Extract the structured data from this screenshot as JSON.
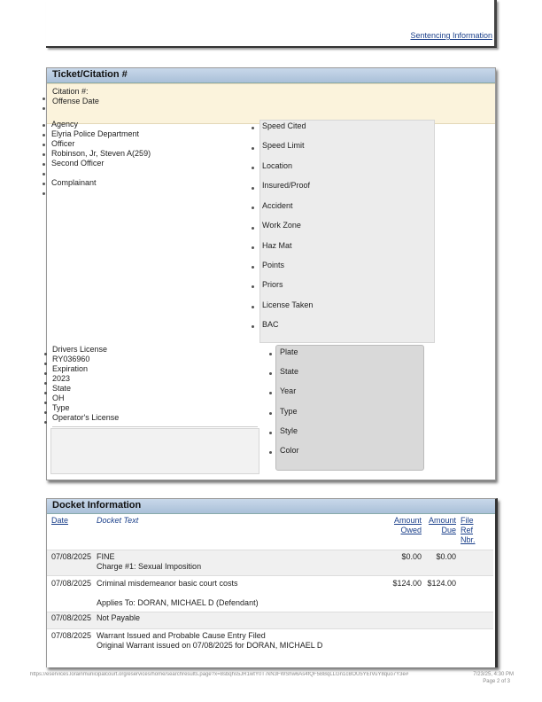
{
  "top": {
    "sentencing_link": "Sentencing Information"
  },
  "ticket": {
    "title": "Ticket/Citation #",
    "citation_label": "Citation #:",
    "offense_date_label": "Offense Date",
    "left": [
      {
        "text": "Agency"
      },
      {
        "text": "Elyria Police Department"
      },
      {
        "text": "Officer"
      },
      {
        "text": "Robinson, Jr, Steven A(259)"
      },
      {
        "text": "Second Officer"
      },
      {
        "text": ""
      },
      {
        "text": "Complainant"
      }
    ],
    "right": [
      "Speed Cited",
      "Speed Limit",
      "Location",
      "Insured/Proof",
      "Accident",
      "Work Zone",
      "Haz Mat",
      "Points",
      "Priors",
      "License Taken",
      "BAC"
    ],
    "license": [
      {
        "text": "Drivers License"
      },
      {
        "text": "RY036960"
      },
      {
        "text": "Expiration"
      },
      {
        "text": "2023"
      },
      {
        "text": "State"
      },
      {
        "text": "OH"
      },
      {
        "text": "Type"
      },
      {
        "text": "Operator's License"
      }
    ],
    "vehicle": [
      "Plate",
      "State",
      "Year",
      "Type",
      "Style",
      "Color"
    ]
  },
  "docket": {
    "title": "Docket Information",
    "headers": {
      "date": "Date",
      "text": "Docket Text",
      "amount_owed_1": "Amount",
      "amount_owed_2": "Owed",
      "amount_due_1": "Amount",
      "amount_due_2": "Due",
      "file_1": "File",
      "file_2": "Ref",
      "file_3": "Nbr."
    },
    "rows": [
      {
        "date": "07/08/2025",
        "line1": "FINE",
        "line2": "Charge #1: Sexual Imposition",
        "line3": "",
        "owed": "$0.00",
        "due": "$0.00"
      },
      {
        "date": "07/08/2025",
        "line1": "Criminal misdemeanor basic court costs",
        "line2": "",
        "line3": "Applies To: DORAN, MICHAEL D (Defendant)",
        "owed": "$124.00",
        "due": "$124.00"
      },
      {
        "date": "07/08/2025",
        "line1": "Not Payable",
        "line2": "",
        "line3": "",
        "owed": "",
        "due": ""
      },
      {
        "date": "07/08/2025",
        "line1": "Warrant Issued and Probable Cause Entry Filed",
        "line2": "Original Warrant issued on 07/08/2025 for DORAN, MICHAEL D",
        "line3": "",
        "owed": "",
        "due": ""
      }
    ]
  },
  "footer": {
    "url": "https://eservices.lorainmunicipalcourt.org/eservices/home/searchresults.page?x=8sbqhs5JR1wtY0T7kN3FWShw6As4fQF5BBqLLGn1cBOU5YEIVuY8quo7Y3e#",
    "datetime": "7/23/25, 4:30 PM",
    "page": "Page 2 of 3"
  }
}
